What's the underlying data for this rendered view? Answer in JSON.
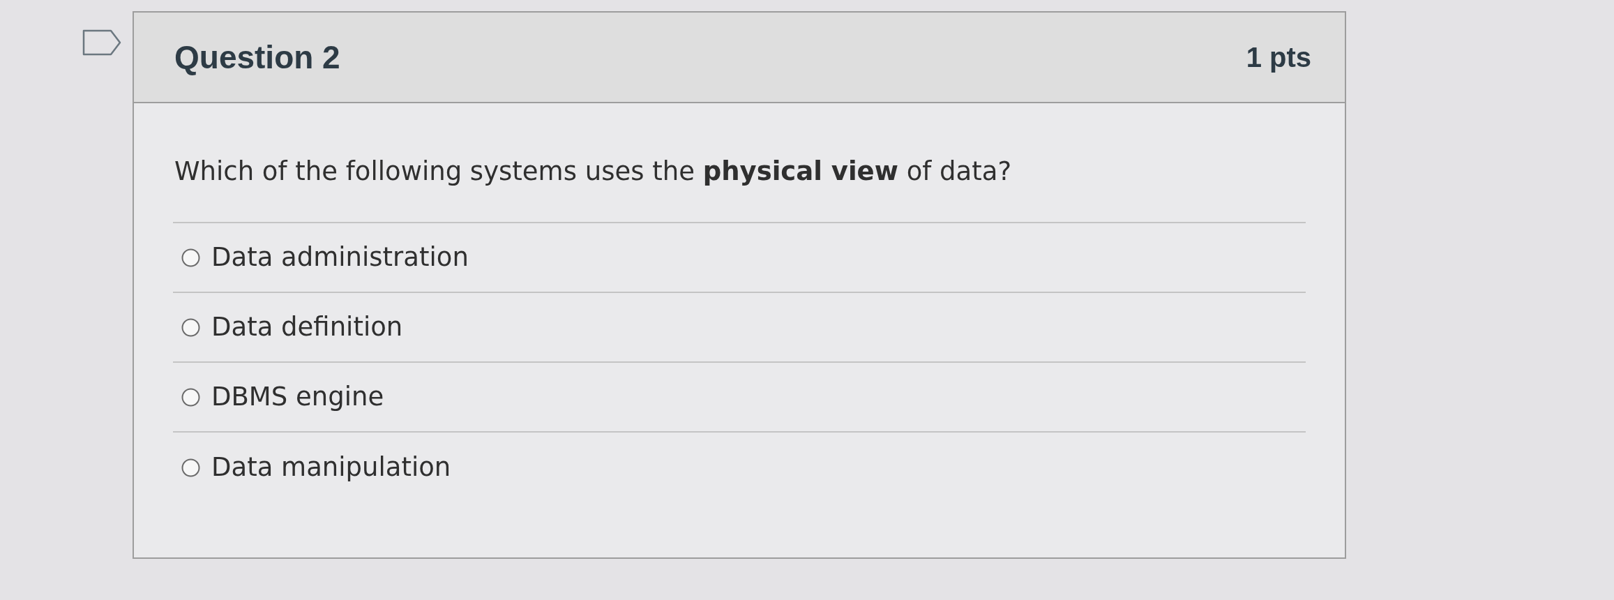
{
  "question": {
    "flagged": false,
    "title": "Question 2",
    "points": "1 pts",
    "prompt": "Which of the following systems uses the **physical view** of data?",
    "options": [
      {
        "label": "Data administration",
        "selected": false
      },
      {
        "label": "Data definition",
        "selected": false
      },
      {
        "label": "DBMS engine",
        "selected": false
      },
      {
        "label": "Data manipulation",
        "selected": false
      }
    ]
  }
}
